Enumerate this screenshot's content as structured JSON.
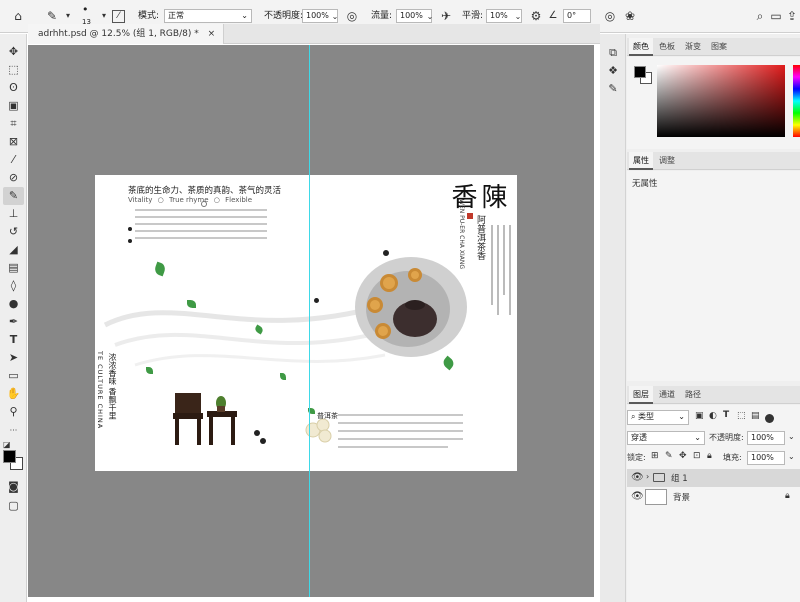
{
  "options_bar": {
    "brush_size": "13",
    "mode_label": "模式:",
    "mode_value": "正常",
    "opacity_label": "不透明度:",
    "opacity_value": "100%",
    "flow_label": "流量:",
    "flow_value": "100%",
    "smoothing_label": "平滑:",
    "smoothing_value": "10%",
    "angle_value": "0°"
  },
  "document_tab": {
    "title": "adrhht.psd @ 12.5% (组 1, RGB/8) *",
    "close": "×"
  },
  "artwork": {
    "headline": "茶底的生命力、茶质的真韵、茶气的灵活",
    "keywords": [
      "Vitality",
      "True rhyme",
      "Flexible"
    ],
    "vertical_title": "陳香",
    "vertical_subtitle": "阿普洱茶香",
    "vertical_en": "WEN PU-ER CHA XIANG",
    "left_vertical_cn": "浓浓香味 香飘千里",
    "left_vertical_en": "TE CULTURE CHINA",
    "pu_er_heading": "普洱茶"
  },
  "color_panel": {
    "tabs": [
      "颜色",
      "色板",
      "渐变",
      "图案"
    ],
    "active_tab": "颜色"
  },
  "properties_panel": {
    "tabs": [
      "属性",
      "调整"
    ],
    "empty_text": "无属性"
  },
  "layers_panel": {
    "tabs": [
      "图层",
      "通道",
      "路径"
    ],
    "filter_kind": "类型",
    "blend_mode": "穿透",
    "opacity_label": "不透明度:",
    "opacity_value": "100%",
    "lock_label": "锁定:",
    "fill_label": "填充:",
    "fill_value": "100%",
    "layers": [
      {
        "name": "组 1",
        "type": "group"
      },
      {
        "name": "背景",
        "type": "background"
      }
    ]
  },
  "colors": {
    "accent_guide": "#3ed9e8",
    "canvas_bg": "#878787",
    "foreground": "#000000",
    "background": "#ffffff"
  }
}
